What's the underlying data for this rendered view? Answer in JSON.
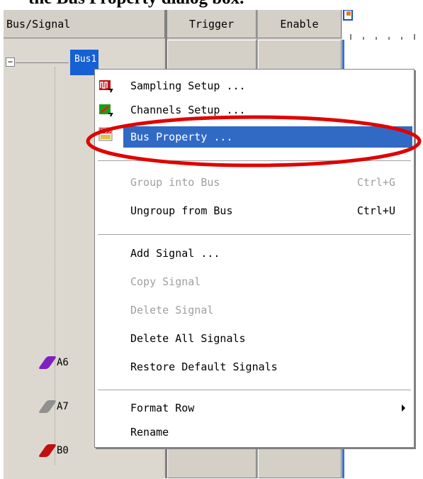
{
  "caption": "the Bus Property dialog box.",
  "columns": {
    "bus_signal": "Bus/Signal",
    "trigger": "Trigger",
    "enable": "Enable"
  },
  "tree": {
    "bus_label": "Bus1",
    "signals": [
      {
        "label": "A6",
        "color": "#8020c0"
      },
      {
        "label": "A7",
        "color": "#909090"
      },
      {
        "label": "B0",
        "color": "#c01010"
      }
    ]
  },
  "context_menu": {
    "items": [
      {
        "label": "Sampling Setup ...",
        "shortcut": "",
        "icon": "sampling-setup-icon",
        "disabled": false
      },
      {
        "label": "Channels Setup ...",
        "shortcut": "",
        "icon": "channels-setup-icon",
        "disabled": false
      },
      {
        "label": "Bus Property ...",
        "shortcut": "",
        "icon": "bus-property-icon",
        "disabled": false,
        "selected": true
      },
      {
        "label": "Group into Bus",
        "shortcut": "Ctrl+G",
        "disabled": true
      },
      {
        "label": "Ungroup from Bus",
        "shortcut": "Ctrl+U",
        "disabled": false
      },
      {
        "label": "Add Signal ...",
        "shortcut": "",
        "disabled": false
      },
      {
        "label": "Copy Signal",
        "shortcut": "",
        "disabled": true
      },
      {
        "label": "Delete Signal",
        "shortcut": "",
        "disabled": true
      },
      {
        "label": "Delete All Signals",
        "shortcut": "",
        "disabled": false
      },
      {
        "label": "Restore Default Signals",
        "shortcut": "",
        "disabled": false
      },
      {
        "label": "Format Row",
        "shortcut": "",
        "disabled": false,
        "submenu": true
      },
      {
        "label": "Rename",
        "shortcut": "",
        "disabled": false
      }
    ]
  },
  "colors": {
    "selection": "#316ac5",
    "highlight_ellipse": "#e00000"
  }
}
